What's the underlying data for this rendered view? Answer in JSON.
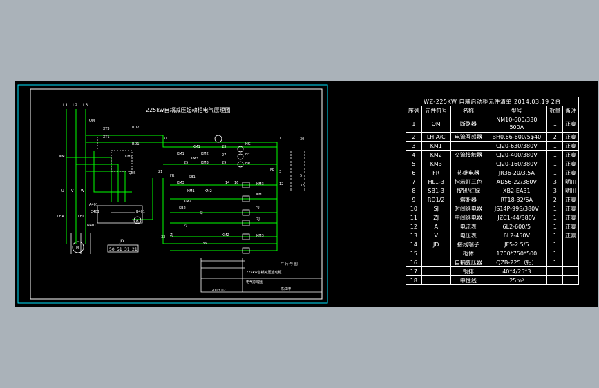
{
  "schematic": {
    "title": "225kw自耦减压起动柜电气原理图",
    "phase_labels": [
      "L1",
      "L2",
      "L3"
    ],
    "labels": {
      "qm": "QM",
      "xt3": "XT3",
      "xt1": "XT1",
      "rd2": "RD2",
      "rd1": "RD1",
      "n31": "31",
      "n1": "1",
      "km1_a": "KM1",
      "km1_b": "KM1",
      "km2_a": "KM2",
      "km3_a": "KM3",
      "km3_b": "KM3",
      "n23": "23",
      "n27": "27",
      "n25": "25",
      "n29": "29",
      "hg": "HG",
      "hy": "HY",
      "hr": "HR",
      "fr_right": "FR",
      "n3": "3",
      "sb1": "SB1",
      "n21": "21",
      "fr_left": "FR",
      "km3_c": "KM3",
      "km3_d": "KM3",
      "n14": "14",
      "n16": "16",
      "km1_c": "KM1",
      "km2_b": "KM2",
      "km2_c": "KM2",
      "sj_a": "SJ",
      "zj_a": "ZJ",
      "sj_b": "SJ",
      "zj_b": "ZJ",
      "km3_e": "KM3",
      "km1_d": "KM1",
      "sb2": "SB2",
      "km2_d": "KM2",
      "n33": "33",
      "zj_c": "ZJ",
      "n12": "12",
      "n36": "36",
      "n30": "30",
      "n5": "5",
      "n32": "32",
      "km1_e": "KM1",
      "km2_e": "KM2",
      "qbs": "QBS",
      "u": "U",
      "v": "V",
      "w": "W",
      "lha": "LHA",
      "lhc": "LHC",
      "a401": "A401",
      "c401": "C401",
      "b401": "B401",
      "n401": "N401",
      "m": "M",
      "a": "A",
      "jd": "JD",
      "jd_1": "50",
      "jd_2": "51",
      "jd_3": "31",
      "jd_4": "21"
    },
    "title_block": {
      "r1": "厂 片 号 图",
      "r2": "225kw自耦减压起动柜",
      "r3": "电气原理图",
      "r4": "2013.02",
      "r5": "陈江坤"
    }
  },
  "bom": {
    "caption": "WZ-225KW  自耦启动柜元件清单  2014.03.19  2台",
    "headers": [
      "序列",
      "元件符号",
      "名称",
      "型号",
      "数量",
      "备注"
    ],
    "rows": [
      [
        "1",
        "QM",
        "断路器",
        "NM10-600/330\n500A",
        "1",
        "正泰"
      ],
      [
        "2",
        "LH A/C",
        "电流互感器",
        "BH0.66-600/5φ40",
        "2",
        "正泰"
      ],
      [
        "3",
        "KM1",
        "",
        "CJ20-630/380V",
        "1",
        "正泰"
      ],
      [
        "4",
        "KM2",
        "交流接触器",
        "CJ20-400/380V",
        "1",
        "正泰"
      ],
      [
        "5",
        "KM3",
        "",
        "CJ20-160/380V",
        "1",
        "正泰"
      ],
      [
        "6",
        "FR",
        "热继电器",
        "JR36-20/3.5A",
        "1",
        "正泰"
      ],
      [
        "7",
        "HL1-3",
        "指示灯三色",
        "AD56-22/380V",
        "3",
        "明川"
      ],
      [
        "8",
        "SB1-3",
        "按钮/红绿",
        "XB2-EA31",
        "3",
        "明川"
      ],
      [
        "9",
        "RD1/2",
        "熔断器",
        "RT18-32/6A",
        "2",
        "正泰"
      ],
      [
        "10",
        "SJ",
        "时间继电器",
        "JS14P-99S/380V",
        "1",
        "正泰"
      ],
      [
        "11",
        "ZJ",
        "中间继电器",
        "JZC1-44/380V",
        "1",
        "正泰"
      ],
      [
        "12",
        "A",
        "电流表",
        "6L2-600/5",
        "1",
        "正泰"
      ],
      [
        "13",
        "V",
        "电压表",
        "6L2-450V",
        "1",
        "正泰"
      ],
      [
        "14",
        "JD",
        "接线端子",
        "JF5-2.5/5",
        "1",
        ""
      ],
      [
        "15",
        "",
        "柜体",
        "1700*750*500",
        "1",
        ""
      ],
      [
        "16",
        "",
        "自耦变压器",
        "QZB-225（铝）",
        "1",
        ""
      ],
      [
        "17",
        "",
        "铜排",
        "40*4/25*3",
        "",
        ""
      ],
      [
        "18",
        "",
        "中性线",
        "25m²",
        "",
        ""
      ]
    ]
  }
}
